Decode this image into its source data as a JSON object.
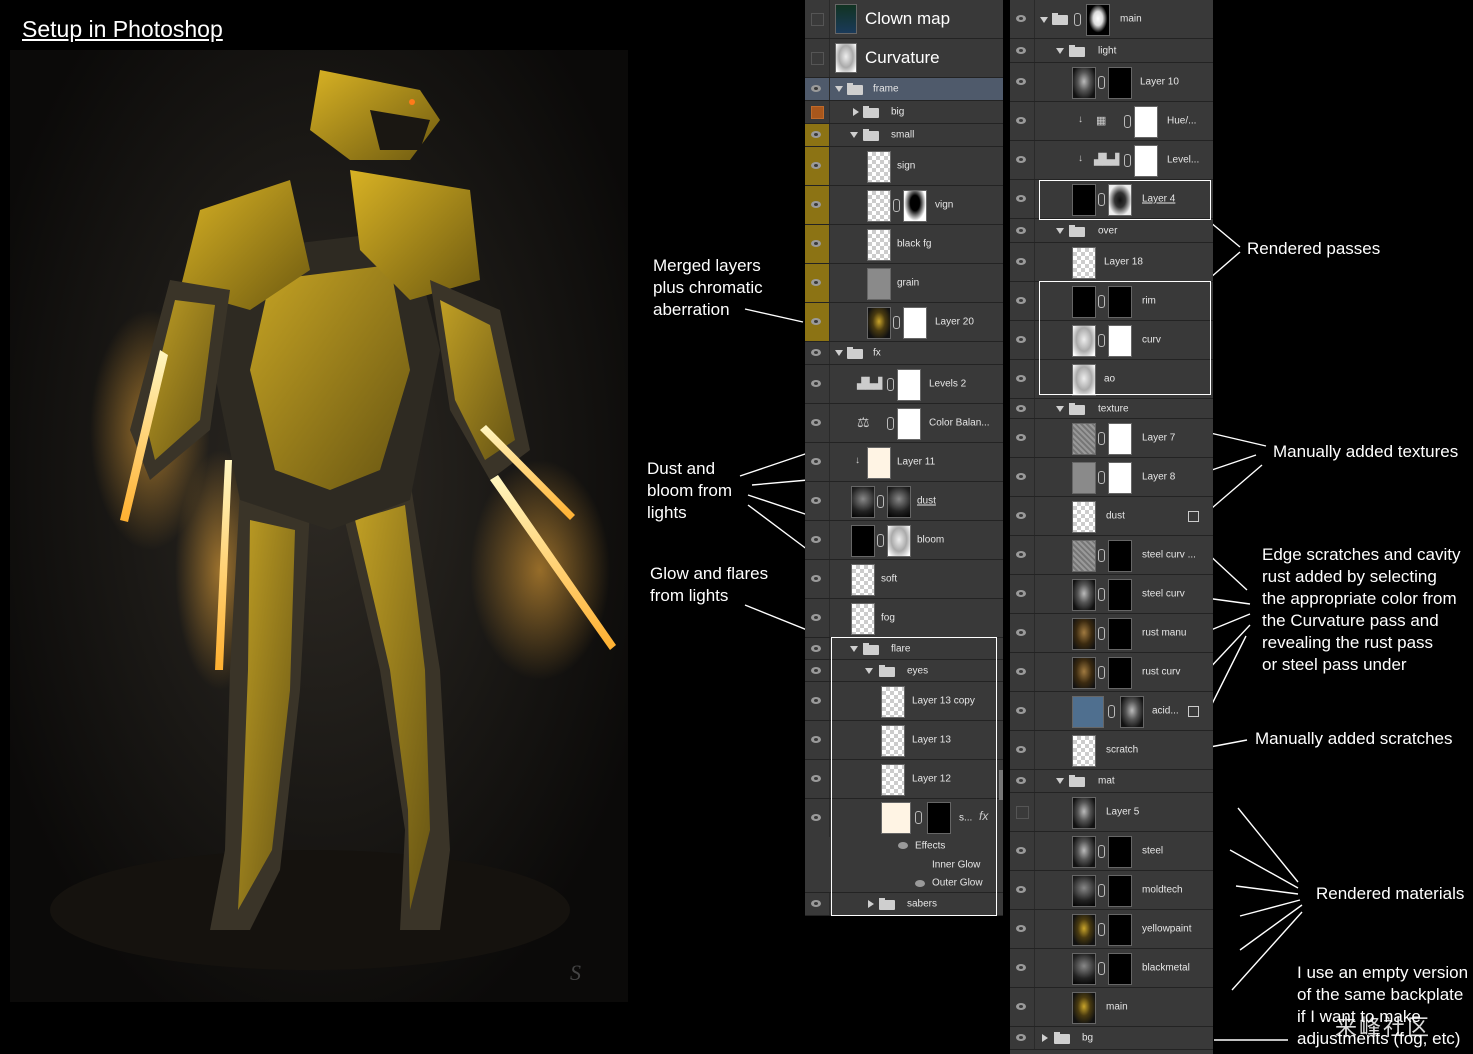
{
  "title": "Setup in Photoshop",
  "notes": {
    "merged": "Merged layers\nplus chromatic\naberration",
    "dust": "Dust and\nbloom from\nlights",
    "glow": "Glow and flares\nfrom lights",
    "rendered_passes": "Rendered passes",
    "manual_textures": "Manually added textures",
    "edge": "Edge scratches and cavity\nrust added by selecting\nthe appropriate color from\nthe Curvature pass and\nrevealing the rust pass\nor steel pass under",
    "manual_scratches": "Manually added scratches",
    "rendered_materials": "Rendered materials",
    "empty_version": "I use an empty version\nof the same backplate\nif I want to make\nadjustments (fog, etc)"
  },
  "left_panel": {
    "top": [
      "Clown map",
      "Curvature"
    ],
    "layers": [
      "frame",
      "big",
      "small",
      "sign",
      "vign",
      "black fg",
      "grain",
      "Layer 20",
      "fx",
      "Levels 2",
      "Color Balan...",
      "Layer 11",
      "dust",
      "bloom",
      "soft",
      "fog",
      "flare",
      "eyes",
      "Layer 13 copy",
      "Layer 13",
      "Layer 12",
      "s...",
      "Effects",
      "Inner Glow",
      "Outer Glow",
      "sabers"
    ]
  },
  "right_panel": {
    "layers": [
      "main",
      "light",
      "Layer 10",
      "Hue/...",
      "Level...",
      "Layer 4",
      "over",
      "Layer 18",
      "rim",
      "curv",
      "ao",
      "texture",
      "Layer 7",
      "Layer 8",
      "dust",
      "steel curv ...",
      "steel curv",
      "rust manu",
      "rust curv",
      "acid...",
      "scratch",
      "mat",
      "Layer 5",
      "steel",
      "moldtech",
      "yellowpaint",
      "blackmetal",
      "main",
      "bg"
    ]
  },
  "fx_symbol": "fx",
  "watermark": "来峰社区",
  "colors": {
    "visible_yellow": "#8c7314",
    "selected": "#4f5a6b",
    "panel": "#393939"
  }
}
